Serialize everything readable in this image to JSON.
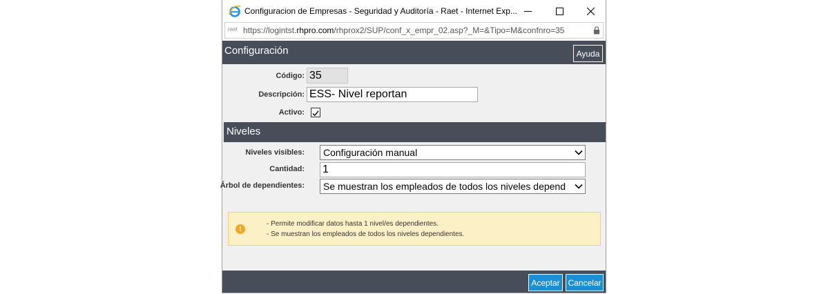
{
  "window": {
    "title": "Configuracion de Empresas - Seguridad y Auditoría - Raet - Internet Exp...",
    "address_prefix": "https://logintst.",
    "address_domain": "rhpro.com",
    "address_path": "/rhprox2/SUP/conf_x_empr_02.asp?_M=&Tipo=M&confnro=35",
    "site_icon_text": "raet"
  },
  "header": {
    "title": "Configuración",
    "help_label": "Ayuda"
  },
  "form": {
    "codigo_label": "Código:",
    "codigo_value": "35",
    "descripcion_label": "Descripción:",
    "descripcion_value": "ESS- Nivel reportan",
    "activo_label": "Activo:",
    "activo_checked": true
  },
  "niveles": {
    "title": "Niveles",
    "visibles_label": "Niveles visibles:",
    "visibles_value": "Configuración manual",
    "cantidad_label": "Cantidad:",
    "cantidad_value": "1",
    "arbol_label": "Árbol de dependientes:",
    "arbol_value": "Se muestran los empleados de todos los niveles depend"
  },
  "notice": {
    "icon": "!",
    "line1": "- Permite modificar datos hasta 1 nivel/es dependientes.",
    "line2": "- Se muestran los empleados de todos los niveles dependientes."
  },
  "footer": {
    "accept_label": "Aceptar",
    "cancel_label": "Cancelar"
  },
  "colors": {
    "header_bg": "#474e5a",
    "button_blue": "#1a8fd4",
    "notice_bg": "#fcf0c7"
  }
}
